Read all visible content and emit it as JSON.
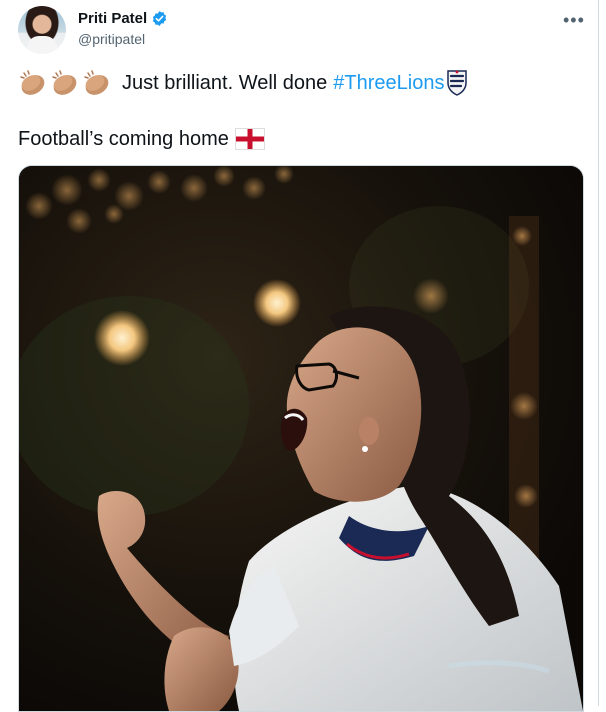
{
  "tweet": {
    "author": {
      "display_name": "Priti Patel",
      "handle": "@pritipatel",
      "verified": true,
      "avatar_icon": "profile-photo"
    },
    "more_menu_icon": "more-horizontal-icon",
    "line1": {
      "emojis": [
        "clapping-hands-icon",
        "clapping-hands-icon",
        "clapping-hands-icon"
      ],
      "text": "Just brilliant. Well done",
      "hashtag": "#ThreeLions",
      "trailing_emoji": "three-lions-crest-icon"
    },
    "line2": {
      "text": "Football’s coming home",
      "trailing_emoji": "england-flag-icon"
    },
    "media": {
      "type": "photo"
    }
  },
  "colors": {
    "link": "#1d9bf0",
    "verified": "#1d9bf0",
    "secondary_text": "#536471",
    "border": "#cfd9de"
  }
}
